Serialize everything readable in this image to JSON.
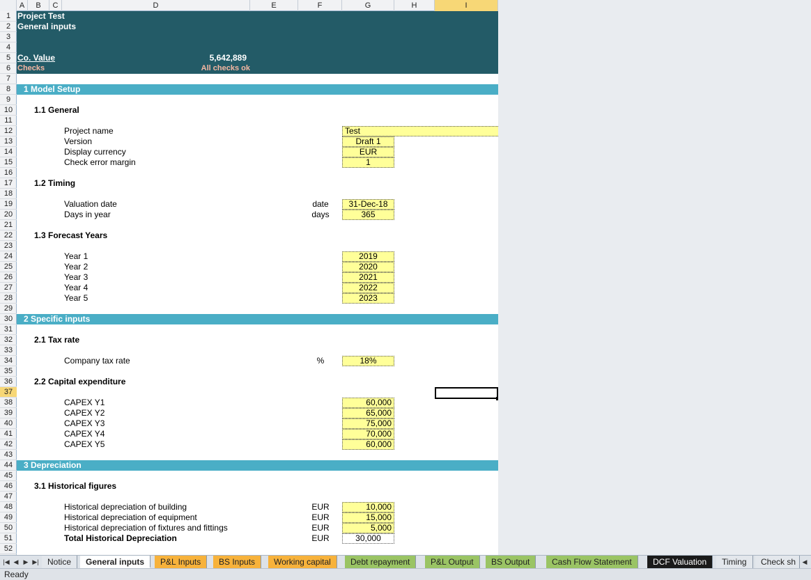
{
  "columns": [
    "A",
    "B",
    "C",
    "D",
    "E",
    "F",
    "G",
    "H",
    "I"
  ],
  "selected_column": "I",
  "selected_row": "37",
  "rows": [
    "1",
    "2",
    "3",
    "4",
    "5",
    "6",
    "7",
    "8",
    "9",
    "10",
    "11",
    "12",
    "13",
    "14",
    "15",
    "16",
    "17",
    "18",
    "19",
    "20",
    "21",
    "22",
    "23",
    "24",
    "25",
    "26",
    "27",
    "28",
    "29",
    "30",
    "31",
    "32",
    "33",
    "34",
    "35",
    "36",
    "37",
    "38",
    "39",
    "40",
    "41",
    "42",
    "43",
    "44",
    "45",
    "46",
    "47",
    "48",
    "49",
    "50",
    "51",
    "52"
  ],
  "header": {
    "project_title": "Project Test",
    "sheet_title": "General inputs",
    "co_value_label": "Co. Value",
    "co_value": "5,642,889",
    "checks_label": "Checks",
    "checks_status": "All checks ok"
  },
  "sections": {
    "s1": "1  Model Setup",
    "s2": "2  Specific inputs",
    "s3": "3  Depreciation"
  },
  "subsections": {
    "general": "1.1  General",
    "timing": "1.2  Timing",
    "forecast": "1.3  Forecast Years",
    "tax": "2.1  Tax rate",
    "capex": "2.2  Capital expenditure",
    "hist": "3.1  Historical figures"
  },
  "general": {
    "project_name_label": "Project name",
    "project_name": "Test",
    "version_label": "Version",
    "version": "Draft 1",
    "currency_label": "Display currency",
    "currency": "EUR",
    "margin_label": "Check error margin",
    "margin": "1"
  },
  "timing": {
    "valuation_label": "Valuation date",
    "valuation_unit": "date",
    "valuation_value": "31-Dec-18",
    "days_label": "Days in year",
    "days_unit": "days",
    "days_value": "365"
  },
  "forecast": {
    "labels": [
      "Year 1",
      "Year 2",
      "Year 3",
      "Year 4",
      "Year 5"
    ],
    "values": [
      "2019",
      "2020",
      "2021",
      "2022",
      "2023"
    ]
  },
  "tax": {
    "label": "Company tax rate",
    "unit": "%",
    "value": "18%"
  },
  "capex": {
    "labels": [
      "CAPEX Y1",
      "CAPEX Y2",
      "CAPEX Y3",
      "CAPEX Y4",
      "CAPEX Y5"
    ],
    "values": [
      "60,000",
      "65,000",
      "75,000",
      "70,000",
      "60,000"
    ]
  },
  "hist": {
    "labels": [
      "Historical depreciation of building",
      "Historical depreciation of equipment",
      "Historical depreciation of fixtures and fittings"
    ],
    "units": [
      "EUR",
      "EUR",
      "EUR"
    ],
    "values": [
      "10,000",
      "15,000",
      "5,000"
    ],
    "total_label": "Total Historical Depreciation",
    "total_unit": "EUR",
    "total_value": "30,000"
  },
  "tabs": [
    "Notice",
    "General inputs",
    "P&L Inputs",
    "BS Inputs",
    "Working capital",
    "Debt repayment",
    "P&L Output",
    "BS Output",
    "Cash Flow Statement",
    "DCF Valuation",
    "Timing",
    "Check sh"
  ],
  "status": "Ready"
}
